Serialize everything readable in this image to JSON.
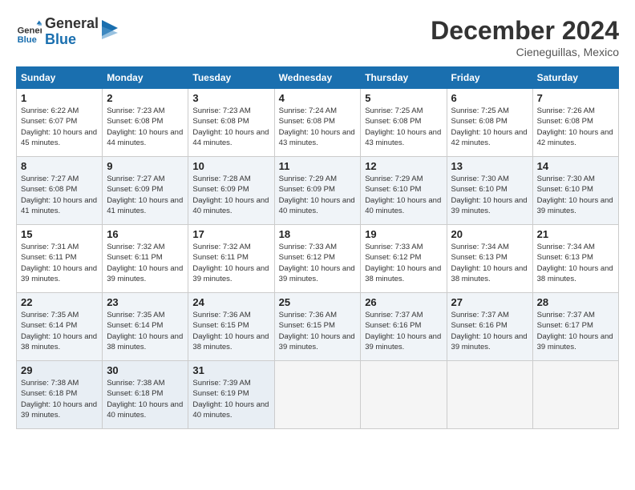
{
  "header": {
    "logo_line1": "General",
    "logo_line2": "Blue",
    "month": "December 2024",
    "location": "Cieneguillas, Mexico"
  },
  "days_of_week": [
    "Sunday",
    "Monday",
    "Tuesday",
    "Wednesday",
    "Thursday",
    "Friday",
    "Saturday"
  ],
  "weeks": [
    [
      {
        "day": "1",
        "sunrise": "6:22 AM",
        "sunset": "6:07 PM",
        "daylight": "10 hours and 45 minutes."
      },
      {
        "day": "2",
        "sunrise": "7:23 AM",
        "sunset": "6:08 PM",
        "daylight": "10 hours and 44 minutes."
      },
      {
        "day": "3",
        "sunrise": "7:23 AM",
        "sunset": "6:08 PM",
        "daylight": "10 hours and 44 minutes."
      },
      {
        "day": "4",
        "sunrise": "7:24 AM",
        "sunset": "6:08 PM",
        "daylight": "10 hours and 43 minutes."
      },
      {
        "day": "5",
        "sunrise": "7:25 AM",
        "sunset": "6:08 PM",
        "daylight": "10 hours and 43 minutes."
      },
      {
        "day": "6",
        "sunrise": "7:25 AM",
        "sunset": "6:08 PM",
        "daylight": "10 hours and 42 minutes."
      },
      {
        "day": "7",
        "sunrise": "7:26 AM",
        "sunset": "6:08 PM",
        "daylight": "10 hours and 42 minutes."
      }
    ],
    [
      {
        "day": "8",
        "sunrise": "7:27 AM",
        "sunset": "6:08 PM",
        "daylight": "10 hours and 41 minutes."
      },
      {
        "day": "9",
        "sunrise": "7:27 AM",
        "sunset": "6:09 PM",
        "daylight": "10 hours and 41 minutes."
      },
      {
        "day": "10",
        "sunrise": "7:28 AM",
        "sunset": "6:09 PM",
        "daylight": "10 hours and 40 minutes."
      },
      {
        "day": "11",
        "sunrise": "7:29 AM",
        "sunset": "6:09 PM",
        "daylight": "10 hours and 40 minutes."
      },
      {
        "day": "12",
        "sunrise": "7:29 AM",
        "sunset": "6:10 PM",
        "daylight": "10 hours and 40 minutes."
      },
      {
        "day": "13",
        "sunrise": "7:30 AM",
        "sunset": "6:10 PM",
        "daylight": "10 hours and 39 minutes."
      },
      {
        "day": "14",
        "sunrise": "7:30 AM",
        "sunset": "6:10 PM",
        "daylight": "10 hours and 39 minutes."
      }
    ],
    [
      {
        "day": "15",
        "sunrise": "7:31 AM",
        "sunset": "6:11 PM",
        "daylight": "10 hours and 39 minutes."
      },
      {
        "day": "16",
        "sunrise": "7:32 AM",
        "sunset": "6:11 PM",
        "daylight": "10 hours and 39 minutes."
      },
      {
        "day": "17",
        "sunrise": "7:32 AM",
        "sunset": "6:11 PM",
        "daylight": "10 hours and 39 minutes."
      },
      {
        "day": "18",
        "sunrise": "7:33 AM",
        "sunset": "6:12 PM",
        "daylight": "10 hours and 39 minutes."
      },
      {
        "day": "19",
        "sunrise": "7:33 AM",
        "sunset": "6:12 PM",
        "daylight": "10 hours and 38 minutes."
      },
      {
        "day": "20",
        "sunrise": "7:34 AM",
        "sunset": "6:13 PM",
        "daylight": "10 hours and 38 minutes."
      },
      {
        "day": "21",
        "sunrise": "7:34 AM",
        "sunset": "6:13 PM",
        "daylight": "10 hours and 38 minutes."
      }
    ],
    [
      {
        "day": "22",
        "sunrise": "7:35 AM",
        "sunset": "6:14 PM",
        "daylight": "10 hours and 38 minutes."
      },
      {
        "day": "23",
        "sunrise": "7:35 AM",
        "sunset": "6:14 PM",
        "daylight": "10 hours and 38 minutes."
      },
      {
        "day": "24",
        "sunrise": "7:36 AM",
        "sunset": "6:15 PM",
        "daylight": "10 hours and 38 minutes."
      },
      {
        "day": "25",
        "sunrise": "7:36 AM",
        "sunset": "6:15 PM",
        "daylight": "10 hours and 39 minutes."
      },
      {
        "day": "26",
        "sunrise": "7:37 AM",
        "sunset": "6:16 PM",
        "daylight": "10 hours and 39 minutes."
      },
      {
        "day": "27",
        "sunrise": "7:37 AM",
        "sunset": "6:16 PM",
        "daylight": "10 hours and 39 minutes."
      },
      {
        "day": "28",
        "sunrise": "7:37 AM",
        "sunset": "6:17 PM",
        "daylight": "10 hours and 39 minutes."
      }
    ],
    [
      {
        "day": "29",
        "sunrise": "7:38 AM",
        "sunset": "6:18 PM",
        "daylight": "10 hours and 39 minutes."
      },
      {
        "day": "30",
        "sunrise": "7:38 AM",
        "sunset": "6:18 PM",
        "daylight": "10 hours and 40 minutes."
      },
      {
        "day": "31",
        "sunrise": "7:39 AM",
        "sunset": "6:19 PM",
        "daylight": "10 hours and 40 minutes."
      },
      null,
      null,
      null,
      null
    ]
  ]
}
